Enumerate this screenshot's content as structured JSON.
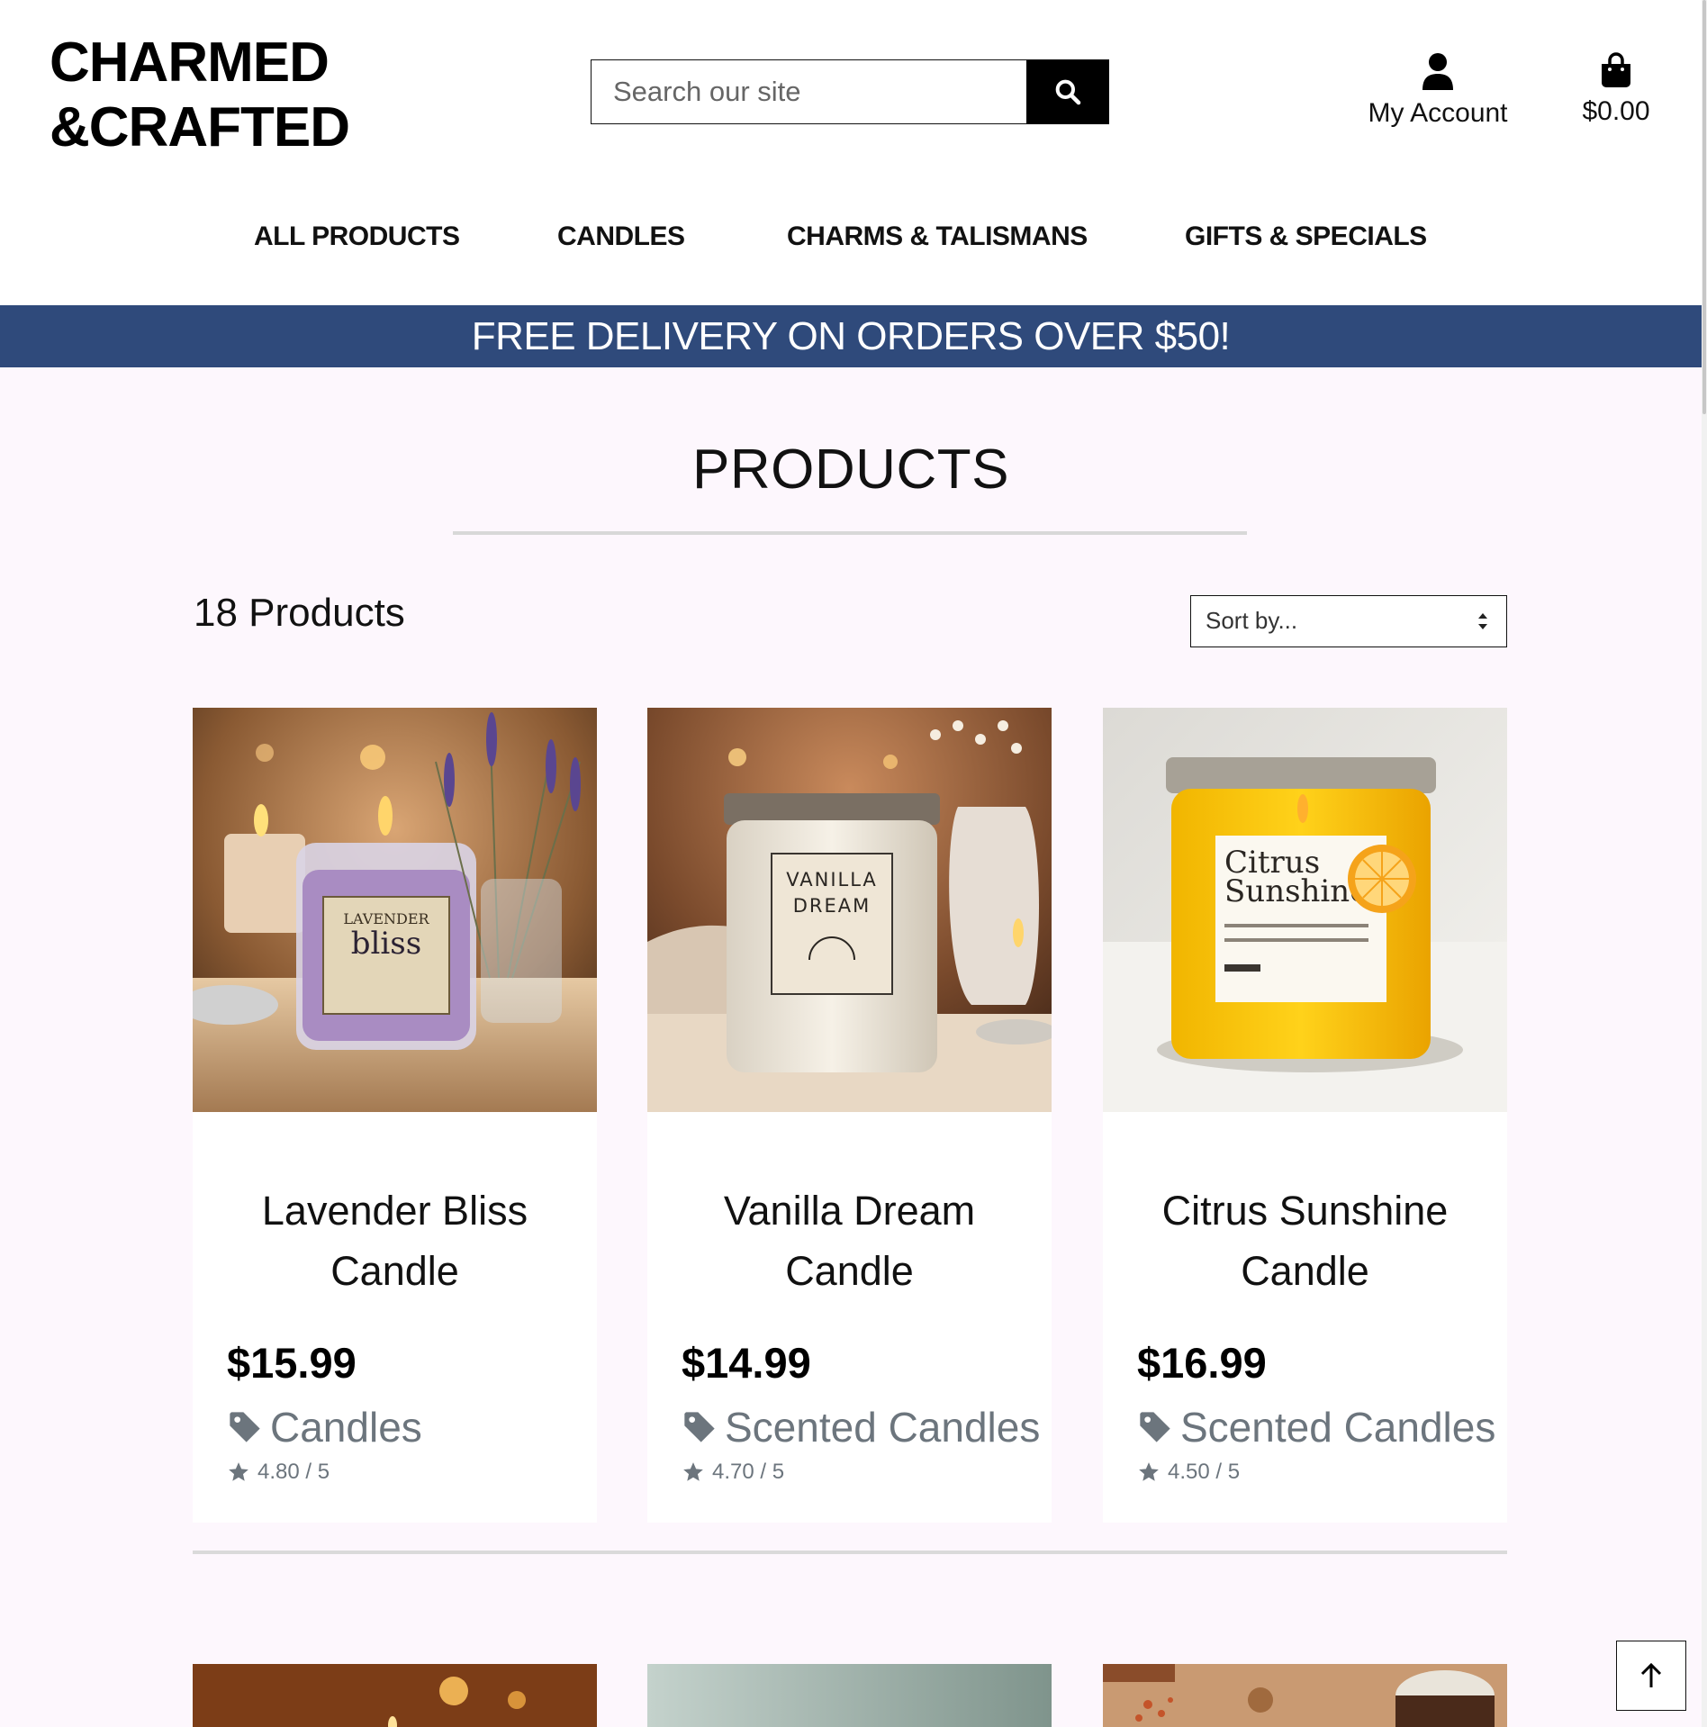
{
  "brand": {
    "line1": "CHARMED",
    "line2": "&CRAFTED"
  },
  "search": {
    "placeholder": "Search our site"
  },
  "account": {
    "label": "My Account"
  },
  "bag": {
    "total": "$0.00"
  },
  "nav": [
    {
      "label": "ALL PRODUCTS"
    },
    {
      "label": "CANDLES"
    },
    {
      "label": "CHARMS & TALISMANS"
    },
    {
      "label": "GIFTS & SPECIALS"
    }
  ],
  "banner": {
    "text": "FREE DELIVERY ON ORDERS OVER $50!"
  },
  "page": {
    "title": "PRODUCTS",
    "count": "18 Products"
  },
  "sort": {
    "selected": "Sort by..."
  },
  "products": [
    {
      "name": "Lavender Bliss Candle",
      "price": "$15.99",
      "category": "Candles",
      "rating": "4.80 / 5",
      "label_line1": "LAVENDER",
      "label_line2": "bliss"
    },
    {
      "name": "Vanilla Dream Candle",
      "price": "$14.99",
      "category": "Scented Candles",
      "rating": "4.70 / 5",
      "label_line1": "VANILLA",
      "label_line2": "DREAM"
    },
    {
      "name": "Citrus Sunshine Candle",
      "price": "$16.99",
      "category": "Scented Candles",
      "rating": "4.50 / 5",
      "label_line1": "Citrus",
      "label_line2": "Sunshine"
    }
  ],
  "colors": {
    "banner": "#2f4a7b",
    "page_bg": "#fdf7fd",
    "muted": "#6c757d"
  },
  "icons": {
    "search": "search-icon",
    "account": "user-icon",
    "bag": "shopping-bag-icon",
    "category": "tag-icon",
    "rating": "star-icon",
    "to_top": "arrow-up-icon"
  }
}
